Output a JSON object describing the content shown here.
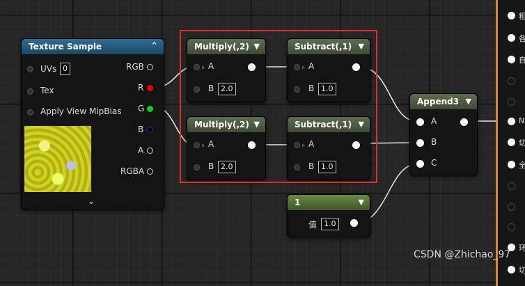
{
  "texture_sample": {
    "title": "Texture Sample",
    "inputs": {
      "uvs_label": "UVs",
      "uvs_value": "0",
      "tex_label": "Tex",
      "mip_label": "Apply View MipBias"
    },
    "outputs": {
      "rgb": "RGB",
      "r": "R",
      "g": "G",
      "b": "B",
      "a": "A",
      "rgba": "RGBA"
    }
  },
  "multiply_1": {
    "title": "Multiply(,2)",
    "a_label": "A",
    "b_label": "B",
    "b_value": "2.0"
  },
  "multiply_2": {
    "title": "Multiply(,2)",
    "a_label": "A",
    "b_label": "B",
    "b_value": "2.0"
  },
  "subtract_1": {
    "title": "Subtract(,1)",
    "a_label": "A",
    "b_label": "B",
    "b_value": "1.0"
  },
  "subtract_2": {
    "title": "Subtract(,1)",
    "a_label": "A",
    "b_label": "B",
    "b_value": "1.0"
  },
  "append3": {
    "title": "Append3",
    "a_label": "A",
    "b_label": "B",
    "c_label": "C"
  },
  "constant": {
    "title": "1",
    "value_label": "值",
    "value": "1.0"
  },
  "right_panel": {
    "labels": [
      "粗",
      "各",
      "自",
      "",
      "",
      "N",
      "切",
      "全",
      "",
      "",
      "",
      "",
      "环",
      "切"
    ]
  },
  "watermark": "CSDN @Zhichao_97",
  "colors": {
    "selection": "#e0302b",
    "panel_border": "#d98b1e",
    "r_pin": "#ee0000",
    "g_pin": "#11cc11",
    "b_pin": "#2222cc"
  }
}
